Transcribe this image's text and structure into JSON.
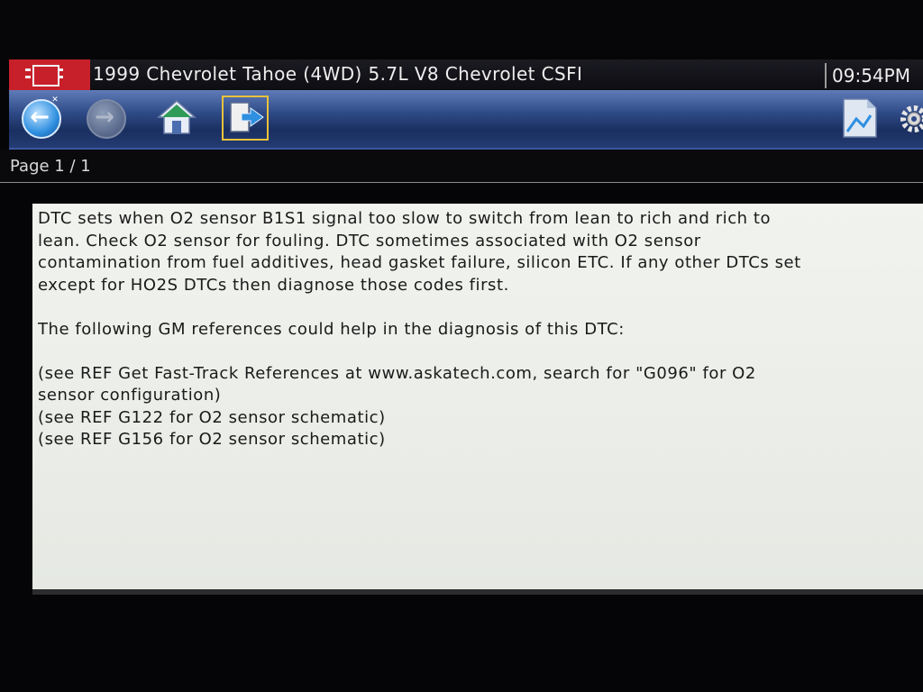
{
  "header": {
    "title": "1999 Chevrolet Tahoe (4WD) 5.7L V8 Chevrolet CSFI",
    "time": "09:54PM"
  },
  "toolbar": {
    "buttons": [
      {
        "name": "back",
        "icon": "back-arrow-icon"
      },
      {
        "name": "forward",
        "icon": "forward-arrow-icon"
      },
      {
        "name": "home",
        "icon": "home-icon"
      },
      {
        "name": "exit",
        "icon": "exit-door-icon"
      },
      {
        "name": "save-screenshot",
        "icon": "image-save-icon"
      },
      {
        "name": "settings",
        "icon": "gear-icon"
      }
    ],
    "colors": {
      "bar": "#2e4a86",
      "selected_border": "#e9c23c",
      "logo": "#c8202a"
    }
  },
  "page_indicator": "Page 1 / 1",
  "content": {
    "paragraph1": [
      "DTC sets when O2 sensor B1S1 signal too slow to switch from lean to rich and rich to",
      "lean.  Check O2 sensor for fouling.  DTC sometimes associated with O2 sensor",
      "contamination from fuel additives, head gasket failure, silicon ETC.  If any other DTCs set",
      "except for HO2S DTCs then diagnose those codes first."
    ],
    "paragraph2": "The following GM references could help in the diagnosis of this DTC:",
    "references": [
      "(see REF  Get Fast-Track References at www.askatech.com, search for \"G096\" for O2",
      "sensor configuration)",
      "(see REF G122 for O2 sensor schematic)",
      "(see REF G156 for O2 sensor schematic)"
    ]
  }
}
